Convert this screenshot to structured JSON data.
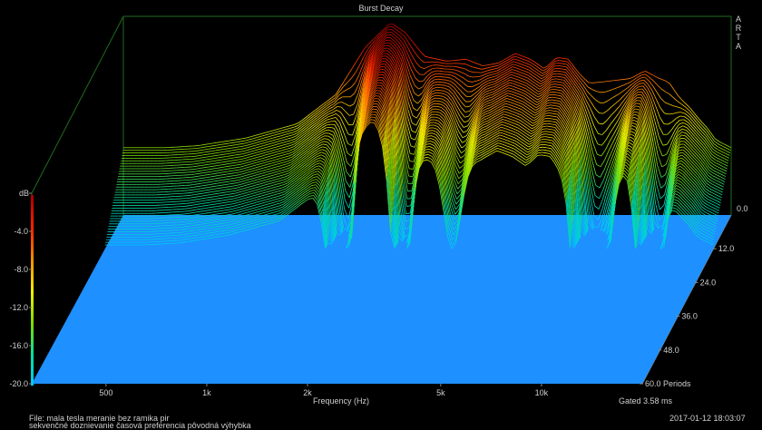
{
  "chart_data": {
    "type": "area",
    "title": "Burst Decay",
    "brand": "ARTA",
    "xlabel": "Frequency (Hz)",
    "x_ticks": [
      {
        "label": "500",
        "value": 500
      },
      {
        "label": "1k",
        "value": 1000
      },
      {
        "label": "2k",
        "value": 2000
      },
      {
        "label": "5k",
        "value": 5000
      },
      {
        "label": "10k",
        "value": 10000
      }
    ],
    "x_range": [
      300,
      20000
    ],
    "x_scale": "log",
    "z_unit": "dB",
    "z_ticks": [
      "0.0",
      "-4.0",
      "-8.0",
      "-12.0",
      "-16.0",
      "-20.0"
    ],
    "z_range": [
      -20,
      0
    ],
    "y_axis_ticks": [
      "0.0",
      "12.0",
      "24.0",
      "36.0",
      "48.0",
      "60.0 Periods"
    ],
    "y_range": [
      0,
      60
    ],
    "first_slice": {
      "freq": [
        300,
        400,
        500,
        700,
        1000,
        1300,
        1600,
        1900,
        2100,
        2400,
        2800,
        3200,
        3600,
        4000,
        4500,
        5000,
        5500,
        6000,
        6500,
        7000,
        7500,
        8000,
        9000,
        10000,
        11000,
        12000,
        13000,
        14000,
        15000,
        16000,
        17000,
        18000,
        20000
      ],
      "db": [
        -13,
        -13,
        -12.8,
        -12,
        -10.5,
        -7.5,
        -2.5,
        0,
        -1,
        -3.5,
        -4,
        -3.8,
        -4.5,
        -4.2,
        -3.2,
        -3.8,
        -4.8,
        -3.6,
        -3.8,
        -5.3,
        -6.3,
        -6.2,
        -6,
        -5.8,
        -5,
        -5.7,
        -6.2,
        -7.8,
        -8.8,
        -10,
        -11,
        -12.2,
        -13
      ]
    },
    "gated": "Gated 3.58 ms"
  },
  "footer": {
    "file": "File: mala tesla meranie bez ramika pir",
    "description": "sekvenčné doznievanie časová preferencia pôvodná výhybka",
    "timestamp": "2017-01-12  18:03:07"
  },
  "colors": {
    "floor": "#1e90ff",
    "frame": "#1f6b1f",
    "scale": [
      "#00c8ff",
      "#00e0a0",
      "#7fdc00",
      "#f0f000",
      "#ff9000",
      "#ff2000",
      "#b00000"
    ]
  }
}
